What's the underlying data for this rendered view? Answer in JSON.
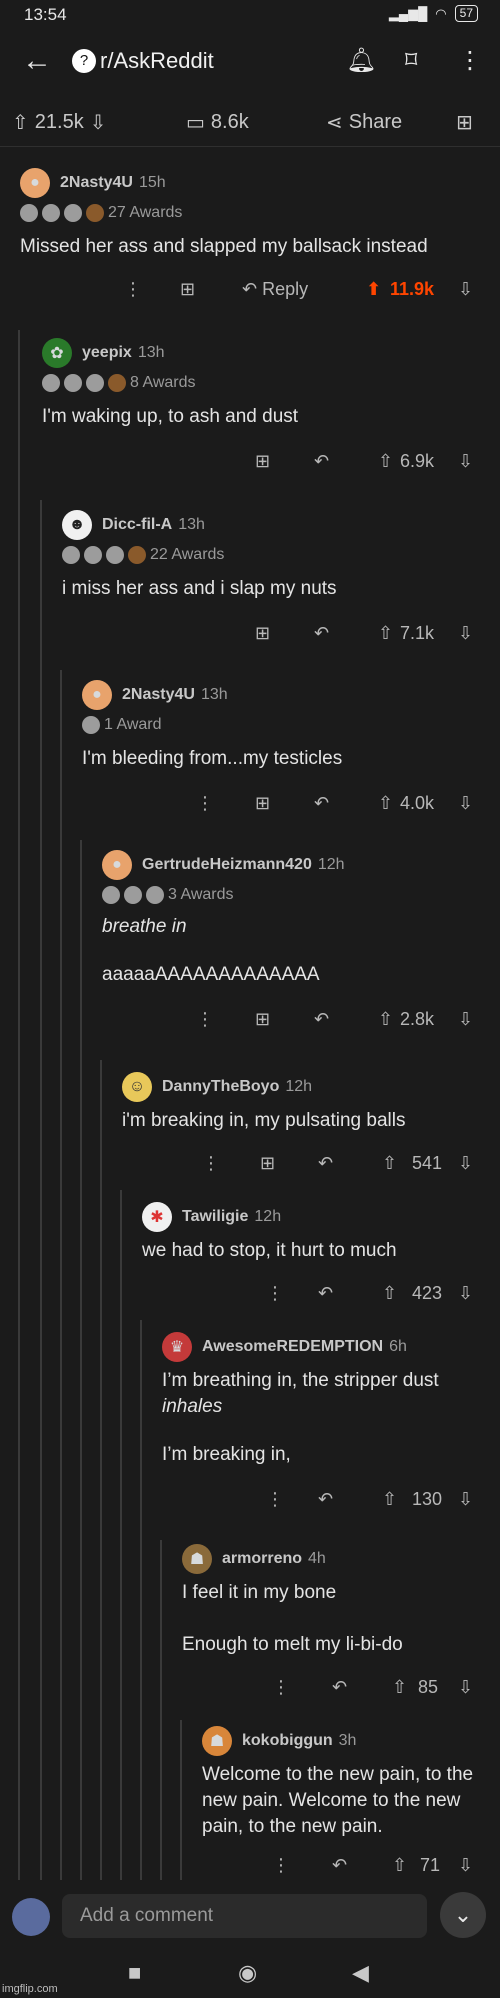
{
  "status": {
    "time": "13:54",
    "battery": "57"
  },
  "header": {
    "subreddit": "r/AskReddit"
  },
  "post_actions": {
    "upvotes": "21.5k",
    "comments": "8.6k",
    "share": "Share"
  },
  "comments": [
    {
      "author": "2Nasty4U",
      "age": "15h",
      "awards": "27 Awards",
      "body": "Missed her ass and slapped my ballsack instead",
      "score": "11.9k",
      "reply": "Reply"
    },
    {
      "author": "yeepix",
      "age": "13h",
      "awards": "8 Awards",
      "body": "I'm waking up, to ash and dust",
      "score": "6.9k"
    },
    {
      "author": "Dicc-fil-A",
      "age": "13h",
      "awards": "22 Awards",
      "body": "i miss her ass and i slap my nuts",
      "score": "7.1k"
    },
    {
      "author": "2Nasty4U",
      "age": "13h",
      "awards": "1 Award",
      "body": "I'm bleeding from...my testicles",
      "score": "4.0k"
    },
    {
      "author": "GertrudeHeizmann420",
      "age": "12h",
      "awards": "3 Awards",
      "body_italic": "breathe in",
      "body": "aaaaaAAAAAAAAAAAAA",
      "score": "2.8k"
    },
    {
      "author": "DannyTheBoyo",
      "age": "12h",
      "body": "i'm breaking in, my pulsating balls",
      "score": "541"
    },
    {
      "author": "Tawiligie",
      "age": "12h",
      "body": "we had to stop, it hurt to much",
      "score": "423"
    },
    {
      "author": "AwesomeREDEMPTION",
      "age": "6h",
      "body": "I’m breathing in, the stripper dust",
      "body_italic": "inhales",
      "body2": "I’m breaking in,",
      "score": "130"
    },
    {
      "author": "armorreno",
      "age": "4h",
      "body": "I feel it in my bone\n\nEnough to melt my li-bi-do",
      "score": "85"
    },
    {
      "author": "kokobiggun",
      "age": "3h",
      "body": "Welcome to the new pain, to the new pain. Welcome to the new pain, to the new pain.",
      "score": "71"
    }
  ],
  "composer": {
    "placeholder": "Add a comment"
  },
  "watermark": "imgflip.com",
  "colors": {
    "background": "#1b1b1b",
    "upvote_active": "#ff4500",
    "thread_line": "#3a3a3a"
  }
}
